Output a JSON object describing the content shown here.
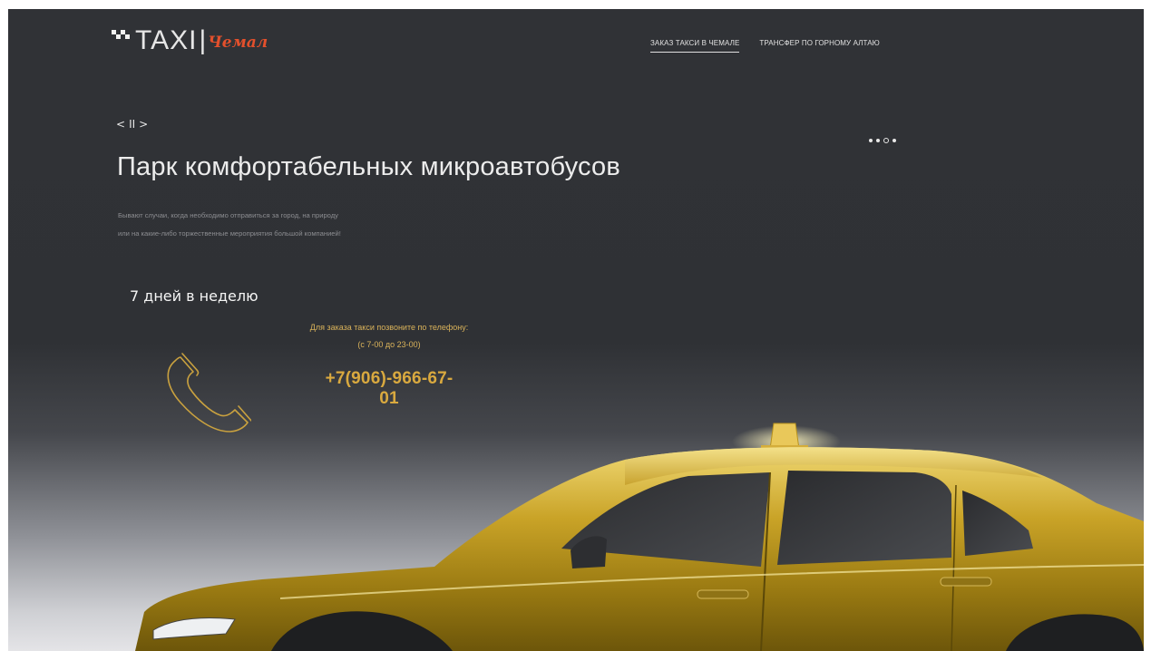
{
  "header": {
    "logo_text": "TAXI",
    "logo_separator": "|",
    "logo_city": "Чемал",
    "nav": [
      {
        "label": "ЗАКАЗ ТАКСИ В ЧЕМАЛЕ",
        "active": true
      },
      {
        "label": "ТРАНСФЕР ПО ГОРНОМУ АЛТАЮ",
        "active": false
      }
    ]
  },
  "slider": {
    "prev": "<",
    "pause": "II",
    "next": ">",
    "dots_total": 4,
    "active_dot": 3
  },
  "hero": {
    "title": "Парк комфортабельных микроавтобусов",
    "desc_line1": "Бывают случаи, когда необходимо отправиться за город, на природу",
    "desc_line2": "или на какие-либо торжественные мероприятия большой компанией!"
  },
  "contact": {
    "days": "7 дней в неделю",
    "call_line1": "Для заказа такси позвоните по телефону:",
    "call_line2": "(с 7-00 до 23-00)",
    "phone": "+7(906)-966-67-01"
  },
  "colors": {
    "background": "#303236",
    "accent_gold": "#d9a93f",
    "logo_city": "#e3502c"
  }
}
